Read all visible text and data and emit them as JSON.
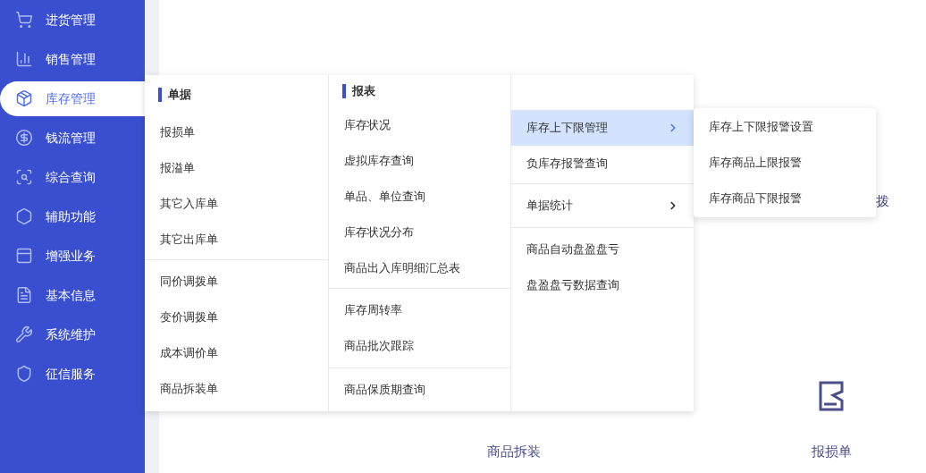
{
  "sidebar": {
    "items": [
      {
        "label": "进货管理",
        "selected": false
      },
      {
        "label": "销售管理",
        "selected": false
      },
      {
        "label": "库存管理",
        "selected": true
      },
      {
        "label": "钱流管理",
        "selected": false
      },
      {
        "label": "综合查询",
        "selected": false
      },
      {
        "label": "辅助功能",
        "selected": false
      },
      {
        "label": "增强业务",
        "selected": false
      },
      {
        "label": "基本信息",
        "selected": false
      },
      {
        "label": "系统维护",
        "selected": false
      },
      {
        "label": "征信服务",
        "selected": false
      }
    ]
  },
  "menu": {
    "columns": [
      {
        "title": "单据",
        "groups": [
          {
            "items": [
              {
                "label": "报损单"
              },
              {
                "label": "报溢单"
              },
              {
                "label": "其它入库单"
              },
              {
                "label": "其它出库单"
              }
            ]
          },
          {
            "items": [
              {
                "label": "同价调拨单"
              },
              {
                "label": "变价调拨单"
              },
              {
                "label": "成本调价单"
              },
              {
                "label": "商品拆装单"
              }
            ]
          }
        ]
      },
      {
        "title": "报表",
        "groups": [
          {
            "items": [
              {
                "label": "库存状况"
              },
              {
                "label": "虚拟库存查询"
              },
              {
                "label": "单品、单位查询"
              },
              {
                "label": "库存状况分布"
              },
              {
                "label": "商品出入库明细汇总表"
              }
            ]
          },
          {
            "items": [
              {
                "label": "库存周转率"
              },
              {
                "label": "商品批次跟踪"
              }
            ]
          },
          {
            "items": [
              {
                "label": "商品保质期查询"
              }
            ]
          }
        ]
      },
      {
        "groups": [
          {
            "items": [
              {
                "label": "库存上下限管理",
                "has_submenu": true,
                "selected": true
              },
              {
                "label": "负库存报警查询",
                "has_submenu": false,
                "selected": false
              }
            ]
          },
          {
            "items": [
              {
                "label": "单据统计",
                "has_submenu": true,
                "selected": false
              }
            ]
          },
          {
            "items": [
              {
                "label": "商品自动盘盈盘亏",
                "has_submenu": false,
                "selected": false
              },
              {
                "label": "盘盈盘亏数据查询",
                "has_submenu": false,
                "selected": false
              }
            ]
          }
        ]
      }
    ],
    "submenu": {
      "items": [
        {
          "label": "库存上下限报警设置"
        },
        {
          "label": "库存商品上限报警"
        },
        {
          "label": "库存商品下限报警"
        }
      ]
    }
  },
  "background": {
    "top_right_label": "拨",
    "tiles": [
      {
        "label": "商品拆装",
        "kind": "plain"
      },
      {
        "label": "报损单",
        "kind": "icon"
      }
    ]
  }
}
